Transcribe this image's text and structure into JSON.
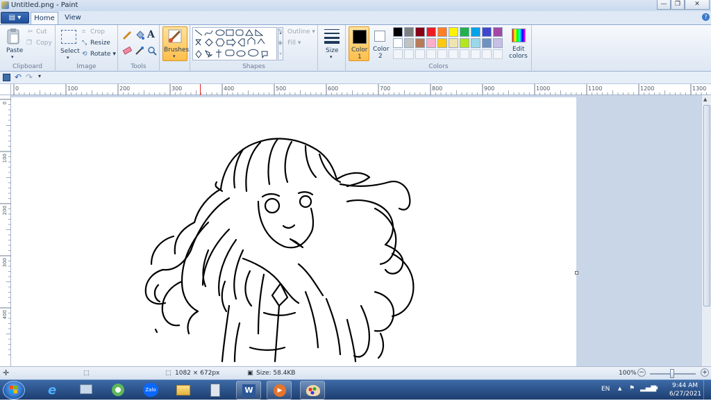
{
  "window": {
    "title": "Untitled.png - Paint",
    "minimize_glyph": "—",
    "restore_glyph": "❐",
    "close_glyph": "✕"
  },
  "ribbon_tabs": {
    "file_glyph": "▤ ▾",
    "home": "Home",
    "view": "View"
  },
  "clipboard": {
    "paste": "Paste",
    "cut": "Cut",
    "copy": "Copy",
    "group_label": "Clipboard"
  },
  "image": {
    "select": "Select",
    "crop": "Crop",
    "resize": "Resize",
    "rotate": "Rotate ▾",
    "group_label": "Image"
  },
  "tools": {
    "group_label": "Tools"
  },
  "brushes": {
    "label": "Brushes"
  },
  "shapes": {
    "outline": "Outline ▾",
    "fill": "Fill ▾",
    "group_label": "Shapes"
  },
  "size": {
    "label": "Size"
  },
  "colors": {
    "color1_label": "Color",
    "color1_num": "1",
    "color2_label": "Color",
    "color2_num": "2",
    "edit_label_1": "Edit",
    "edit_label_2": "colors",
    "group_label": "Colors",
    "color1_value": "#000000",
    "color2_value": "#ffffff",
    "palette_row1": [
      "#000000",
      "#7f7f7f",
      "#880015",
      "#ed1c24",
      "#ff7f27",
      "#fff200",
      "#22b14c",
      "#00a2e8",
      "#3f48cc",
      "#a349a4"
    ],
    "palette_row2": [
      "#ffffff",
      "#c3c3c3",
      "#b97a57",
      "#ffaec9",
      "#ffc90e",
      "#efe4b0",
      "#b5e61d",
      "#99d9ea",
      "#7092be",
      "#c8bfe7"
    ]
  },
  "ruler": {
    "h_labels": [
      "0",
      "100",
      "200",
      "300",
      "400",
      "500",
      "600",
      "700",
      "800",
      "900",
      "1000",
      "1100",
      "1200",
      "1300"
    ],
    "v_labels": [
      "0",
      "100",
      "200",
      "300",
      "400"
    ]
  },
  "status": {
    "dimensions": "1082 × 672px",
    "size": "Size: 58.4KB",
    "zoom": "100%",
    "zoom_minus": "−",
    "zoom_plus": "+"
  },
  "taskbar": {
    "language": "EN",
    "time": "9:44 AM",
    "date": "6/27/2021",
    "zalo": "Zalo"
  }
}
